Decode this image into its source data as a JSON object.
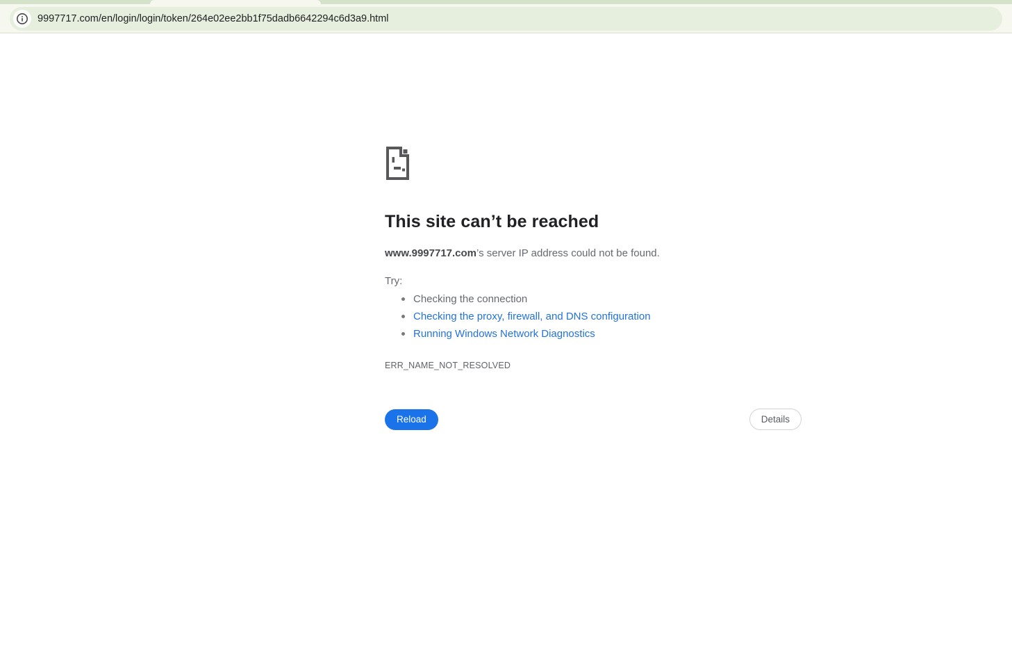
{
  "browser": {
    "url": "9997717.com/en/login/login/token/264e02ee2bb1f75dadb6642294c6d3a9.html",
    "theme": {
      "tab_strip_bg": "#d4e2ca",
      "toolbar_bg": "#f6f8f0",
      "omnibox_bg": "#e6eedd"
    },
    "icons": {
      "site_info": "info-icon"
    }
  },
  "error_page": {
    "icon": "sad-file-icon",
    "title": "This site can’t be reached",
    "message_domain": "www.9997717.com",
    "message_rest": "’s server IP address could not be found.",
    "try_label": "Try:",
    "suggestions": [
      {
        "label": "Checking the connection",
        "link": false
      },
      {
        "label": "Checking the proxy, firewall, and DNS configuration",
        "link": true
      },
      {
        "label": "Running Windows Network Diagnostics",
        "link": true
      }
    ],
    "error_code": "ERR_NAME_NOT_RESOLVED",
    "reload_label": "Reload",
    "details_label": "Details",
    "colors": {
      "button_blue": "#1a73e8",
      "link_blue": "#2272dd",
      "heading": "#202124",
      "body_text": "#656970",
      "icon_gray": "#58585a"
    }
  }
}
